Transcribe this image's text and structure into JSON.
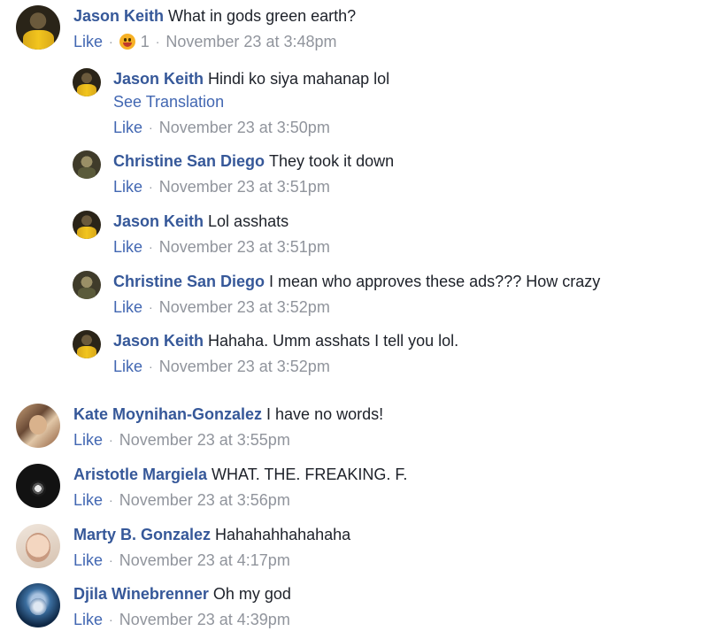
{
  "comments": [
    {
      "author": "Jason Keith",
      "text": "What in gods green earth?",
      "like": "Like",
      "reaction_count": "1",
      "reaction_icon": "haha-reaction-icon",
      "timestamp": "November 23 at 3:48pm"
    },
    {
      "author": "Jason Keith",
      "text": "Hindi ko siya mahanap lol",
      "see_translation": "See Translation",
      "like": "Like",
      "timestamp": "November 23 at 3:50pm"
    },
    {
      "author": "Christine San Diego",
      "text": "They took it down",
      "like": "Like",
      "timestamp": "November 23 at 3:51pm"
    },
    {
      "author": "Jason Keith",
      "text": "Lol asshats",
      "like": "Like",
      "timestamp": "November 23 at 3:51pm"
    },
    {
      "author": "Christine San Diego",
      "text": "I mean who approves these ads??? How crazy",
      "like": "Like",
      "timestamp": "November 23 at 3:52pm"
    },
    {
      "author": "Jason Keith",
      "text": "Hahaha. Umm asshats I tell you lol.",
      "like": "Like",
      "timestamp": "November 23 at 3:52pm"
    },
    {
      "author": "Kate Moynihan-Gonzalez",
      "text": "I have no words!",
      "like": "Like",
      "timestamp": "November 23 at 3:55pm"
    },
    {
      "author": "Aristotle Margiela",
      "text": "WHAT. THE. FREAKING. F.",
      "like": "Like",
      "timestamp": "November 23 at 3:56pm"
    },
    {
      "author": "Marty B. Gonzalez",
      "text": "Hahahahhahahaha",
      "like": "Like",
      "timestamp": "November 23 at 4:17pm"
    },
    {
      "author": "Djila Winebrenner",
      "text": "Oh my god",
      "like": "Like",
      "timestamp": "November 23 at 4:39pm"
    }
  ],
  "colors": {
    "author_link": "#365899",
    "action_link": "#4267b2",
    "meta_text": "#90949c",
    "body_text": "#1d2129"
  }
}
